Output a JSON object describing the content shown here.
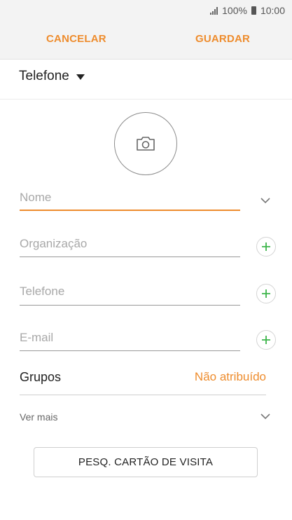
{
  "status_bar": {
    "battery": "100%",
    "time": "10:00"
  },
  "top_bar": {
    "cancel_label": "CANCELAR",
    "save_label": "GUARDAR"
  },
  "account": {
    "selected": "Telefone"
  },
  "fields": {
    "name_placeholder": "Nome",
    "organization_placeholder": "Organização",
    "phone_placeholder": "Telefone",
    "email_placeholder": "E-mail"
  },
  "groups": {
    "label": "Grupos",
    "value": "Não atribuído"
  },
  "more": {
    "label": "Ver mais"
  },
  "scan_card_button": {
    "label": "PESQ. CARTÃO DE VISITA"
  },
  "colors": {
    "accent": "#ee8c2d",
    "plus": "#3cb54a",
    "header_bg": "#f3f3f3"
  },
  "icons": [
    "signal-icon",
    "battery-icon",
    "dropdown-triangle-icon",
    "camera-icon",
    "chevron-down-icon",
    "plus-icon"
  ]
}
